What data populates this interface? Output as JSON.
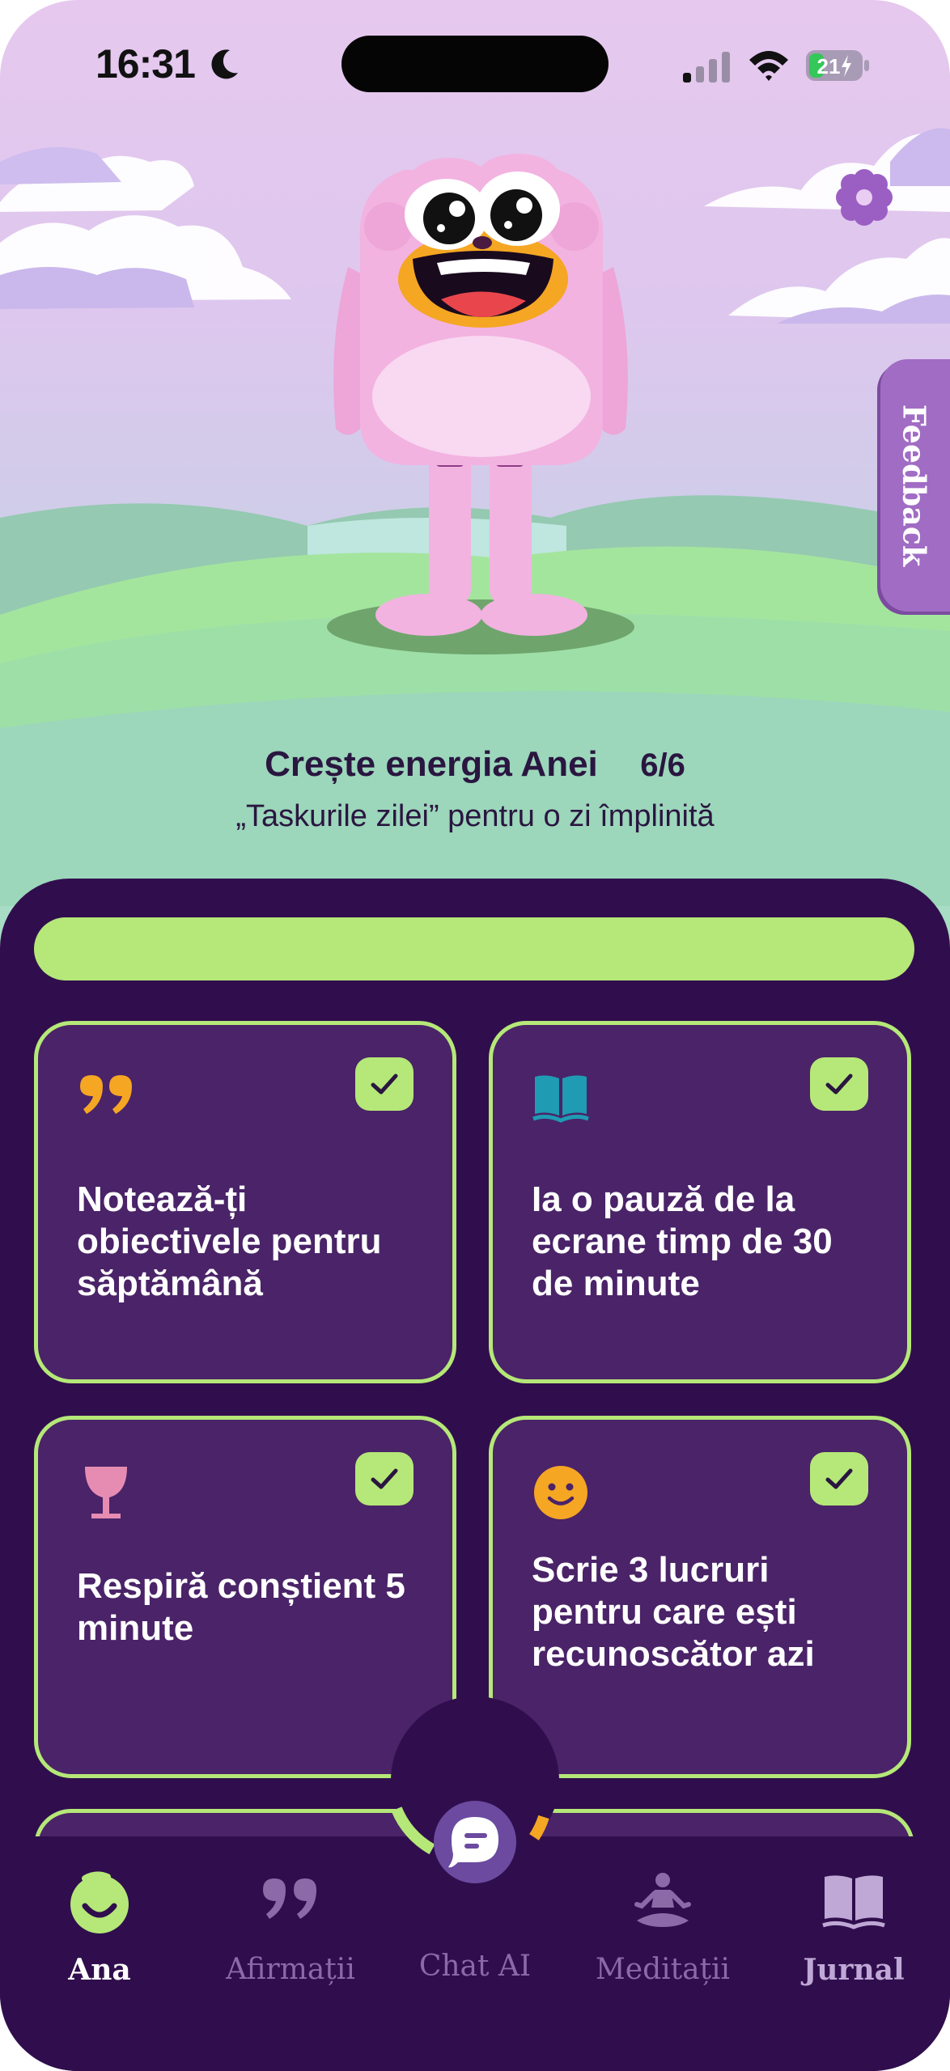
{
  "status_bar": {
    "time": "16:31",
    "battery_level": "21"
  },
  "scene": {
    "feedback_label": "Feedback"
  },
  "energy": {
    "title": "Crește energia Anei",
    "counter": "6/6",
    "subtitle": "„Taskurile zilei” pentru o zi împlinită",
    "progress_fraction": 1.0
  },
  "tasks": [
    {
      "text": "Notează-ți obiectivele pentru săptămână",
      "icon": "quote-icon",
      "done": true
    },
    {
      "text": "Ia o pauză de la ecrane timp de 30 de minute",
      "icon": "book-icon",
      "done": true
    },
    {
      "text": "Respiră conștient 5 minute",
      "icon": "glass-icon",
      "done": true
    },
    {
      "text": "Scrie 3 lucruri pentru care ești recunoscător azi",
      "icon": "smiley-icon",
      "done": true
    }
  ],
  "nav": {
    "items": [
      {
        "label": "Ana",
        "icon": "ana-icon",
        "active": true
      },
      {
        "label": "Afirmații",
        "icon": "quote-icon",
        "active": false
      },
      {
        "label": "Chat AI",
        "icon": "chat-icon",
        "active": false
      },
      {
        "label": "Meditații",
        "icon": "meditation-icon",
        "active": false
      },
      {
        "label": "Jurnal",
        "icon": "journal-icon",
        "active": false
      }
    ]
  },
  "colors": {
    "panel": "#300e4d",
    "card": "#4a2368",
    "accent_green": "#b5e878",
    "feedback_tab": "#a06cc4",
    "character_pink": "#f2b3e1",
    "mouth_orange": "#f5a623"
  }
}
